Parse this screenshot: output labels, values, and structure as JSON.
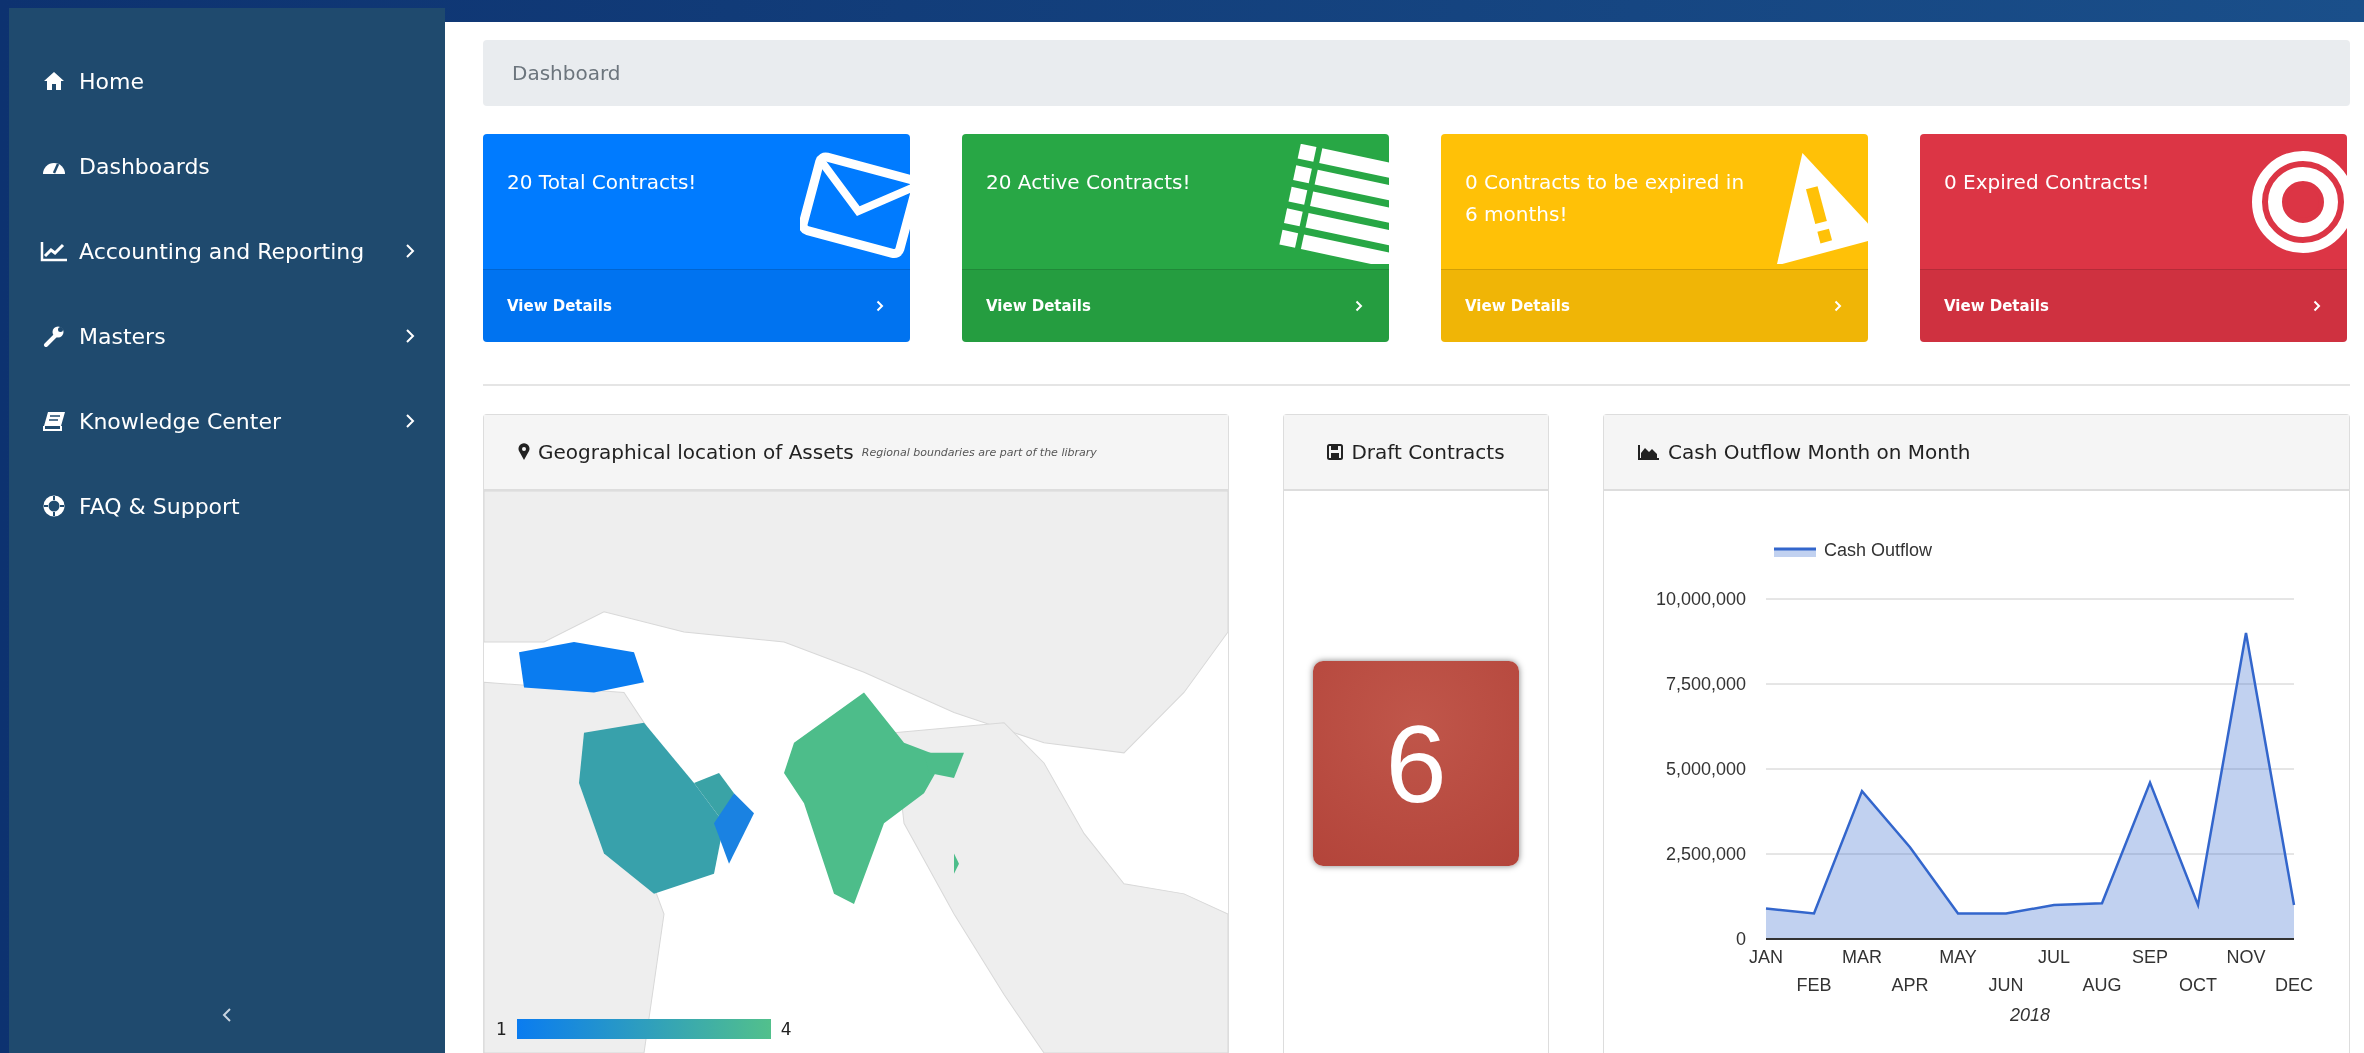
{
  "sidebar": {
    "items": [
      {
        "label": "Home",
        "expandable": false
      },
      {
        "label": "Dashboards",
        "expandable": false
      },
      {
        "label": "Accounting and Reporting",
        "expandable": true
      },
      {
        "label": "Masters",
        "expandable": true
      },
      {
        "label": "Knowledge Center",
        "expandable": true
      },
      {
        "label": "FAQ & Support",
        "expandable": false
      }
    ]
  },
  "breadcrumb": "Dashboard",
  "cards": [
    {
      "title": "20 Total Contracts!",
      "link": "View Details",
      "color": "#007bff"
    },
    {
      "title": "20 Active Contracts!",
      "link": "View Details",
      "color": "#28a745"
    },
    {
      "title": "0 Contracts to be expired in 6 months!",
      "link": "View Details",
      "color": "#ffc107"
    },
    {
      "title": "0 Expired Contracts!",
      "link": "View Details",
      "color": "#dc3545"
    }
  ],
  "map_panel": {
    "title": "Geographical location of Assets",
    "note": "Regional boundaries are part of the library",
    "legend": {
      "min": "1",
      "max": "4"
    }
  },
  "draft_panel": {
    "title": "Draft Contracts",
    "count": "6"
  },
  "chart_panel": {
    "title": "Cash Outflow Month on Month",
    "chart_data": {
      "type": "area",
      "xlabel": "2018",
      "categories": [
        "JAN",
        "FEB",
        "MAR",
        "APR",
        "MAY",
        "JUN",
        "JUL",
        "AUG",
        "SEP",
        "OCT",
        "NOV",
        "DEC"
      ],
      "series": [
        {
          "name": "Cash Outflow",
          "color": "#3366cc",
          "values": [
            900000,
            750000,
            4350000,
            2700000,
            750000,
            750000,
            1000000,
            1050000,
            4600000,
            1000000,
            9000000,
            1000000
          ]
        }
      ],
      "grid": true,
      "ylim": [
        0,
        10000000
      ],
      "yticks": [
        {
          "value": 0,
          "label": "0"
        },
        {
          "value": 2500000,
          "label": "2,500,000"
        },
        {
          "value": 5000000,
          "label": "5,000,000"
        },
        {
          "value": 7500000,
          "label": "7,500,000"
        },
        {
          "value": 10000000,
          "label": "10,000,000"
        }
      ]
    }
  }
}
